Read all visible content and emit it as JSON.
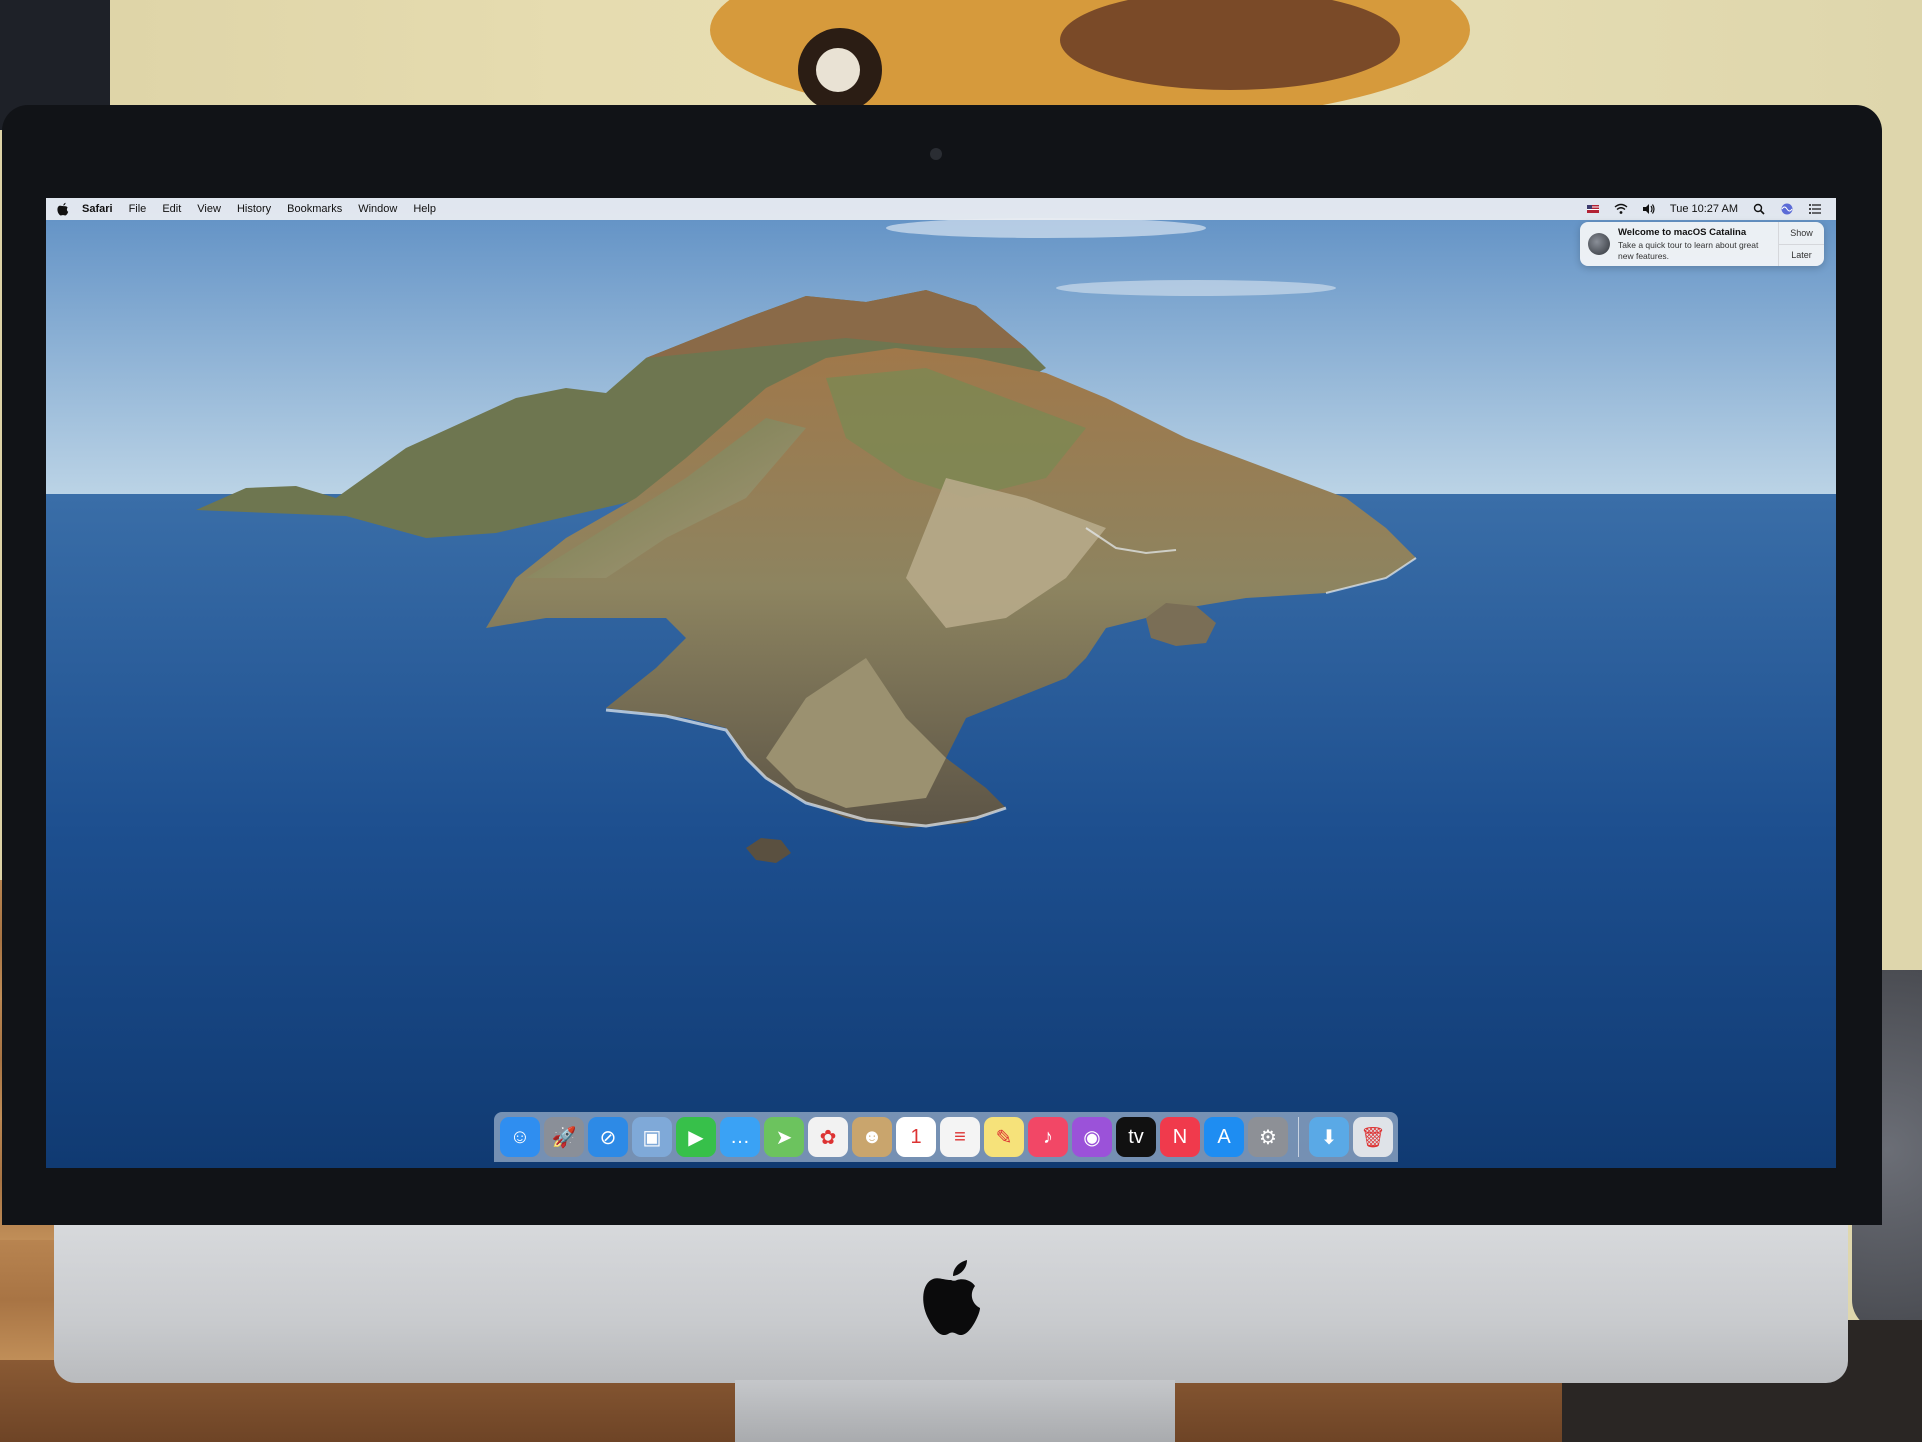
{
  "menubar": {
    "app_name": "Safari",
    "items": [
      "File",
      "Edit",
      "View",
      "History",
      "Bookmarks",
      "Window",
      "Help"
    ],
    "clock": "Tue 10:27 AM",
    "status_icons": [
      "flag-icon",
      "wifi-icon",
      "volume-icon",
      "search-icon",
      "siri-icon",
      "notification-center-icon"
    ]
  },
  "notification": {
    "title": "Welcome to macOS Catalina",
    "text": "Take a quick tour to learn about great new features.",
    "show_label": "Show",
    "later_label": "Later"
  },
  "dock": {
    "apps": [
      {
        "name": "finder-icon",
        "glyph": "☺",
        "color": "#2f8ef0"
      },
      {
        "name": "launchpad-icon",
        "glyph": "🚀",
        "color": "#8a8f98"
      },
      {
        "name": "safari-icon",
        "glyph": "⊘",
        "color": "#2d8ae6"
      },
      {
        "name": "preview-icon",
        "glyph": "▣",
        "color": "#7fa9d8"
      },
      {
        "name": "facetime-icon",
        "glyph": "▶",
        "color": "#37c04a"
      },
      {
        "name": "messages-icon",
        "glyph": "…",
        "color": "#3aa2f5"
      },
      {
        "name": "maps-icon",
        "glyph": "➤",
        "color": "#6cc35e"
      },
      {
        "name": "photos-icon",
        "glyph": "✿",
        "color": "#f2f2f2"
      },
      {
        "name": "contacts-icon",
        "glyph": "☻",
        "color": "#c9a56d"
      },
      {
        "name": "calendar-icon",
        "glyph": "1",
        "color": "#ffffff"
      },
      {
        "name": "reminders-icon",
        "glyph": "≡",
        "color": "#f4f4f4"
      },
      {
        "name": "notes-icon",
        "glyph": "✎",
        "color": "#f6e27a"
      },
      {
        "name": "music-icon",
        "glyph": "♪",
        "color": "#f24766"
      },
      {
        "name": "podcasts-icon",
        "glyph": "◉",
        "color": "#9b52d9"
      },
      {
        "name": "tv-icon",
        "glyph": "tv",
        "color": "#111111"
      },
      {
        "name": "news-icon",
        "glyph": "N",
        "color": "#f03a4c"
      },
      {
        "name": "app-store-icon",
        "glyph": "A",
        "color": "#1e8df2"
      },
      {
        "name": "system-preferences-icon",
        "glyph": "⚙",
        "color": "#8d9096"
      }
    ],
    "right": [
      {
        "name": "downloads-folder-icon",
        "glyph": "⬇",
        "color": "#5aa9e6"
      },
      {
        "name": "trash-icon",
        "glyph": "🗑",
        "color": "#dfe3e8"
      }
    ]
  },
  "colors": {
    "sea": "#1d4f8f",
    "sky": "#9ec1de",
    "menubar": "#eceef2"
  }
}
